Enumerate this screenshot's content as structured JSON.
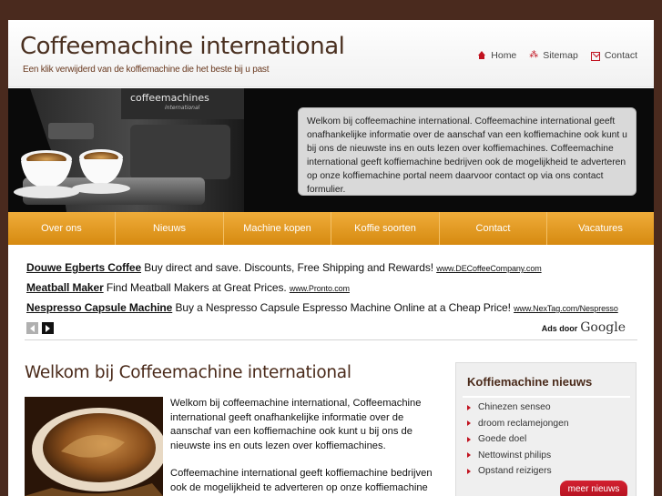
{
  "header": {
    "title": "Coffeemachine international",
    "tagline": "Een klik verwijderd van de koffiemachine die het beste bij u past",
    "links": [
      {
        "label": "Home",
        "icon": "home-icon"
      },
      {
        "label": "Sitemap",
        "icon": "sitemap-icon"
      },
      {
        "label": "Contact",
        "icon": "mail-icon"
      }
    ]
  },
  "banner": {
    "brand_text": "coffeemachines",
    "brand_sub": "international",
    "text": "Welkom bij coffeemachine international. Coffeemachine international geeft onafhankelijke informatie over de aanschaf van een koffiemachine ook kunt u bij ons de nieuwste ins en outs lezen over koffiemachines. Coffeemachine international geeft koffiemachine bedrijven ook de mogelijkheid te adverteren op onze koffiemachine portal neem daarvoor contact op via ons contact formulier."
  },
  "mainnav": [
    "Over ons",
    "Nieuws",
    "Machine kopen",
    "Koffie soorten",
    "Contact",
    "Vacatures"
  ],
  "ads": {
    "items": [
      {
        "title": "Douwe Egberts Coffee",
        "text": "Buy direct and save. Discounts, Free Shipping and Rewards!",
        "url": "www.DECoffeeCompany.com"
      },
      {
        "title": "Meatball Maker",
        "text": "Find Meatball Makers at Great Prices.",
        "url": "www.Pronto.com"
      },
      {
        "title": "Nespresso Capsule Machine",
        "text": "Buy a Nespresso Capsule Espresso Machine Online at a Cheap Price!",
        "url": "www.NexTag.com/Nespresso"
      }
    ],
    "ads_by": "Ads door",
    "google": "Google"
  },
  "main": {
    "title": "Welkom bij Coffeemachine international",
    "paragraphs": [
      "Welkom bij coffeemachine international, Coffeemachine international geeft onafhankelijke informatie over de aanschaf van een koffiemachine ook kunt u bij ons de nieuwste ins en outs lezen over koffiemachines.",
      "Coffeemachine international geeft koffiemachine bedrijven ook de mogelijkheid te adverteren op onze koffiemachine"
    ]
  },
  "sidebar": {
    "title": "Koffiemachine nieuws",
    "items": [
      "Chinezen senseo",
      "droom reclamejongen",
      "Goede doel",
      "Nettowinst philips",
      "Opstand reizigers"
    ],
    "more_label": "meer nieuws"
  },
  "colors": {
    "accent": "#c1121f",
    "menu": "#e39a20",
    "brown": "#4a2a1e"
  }
}
